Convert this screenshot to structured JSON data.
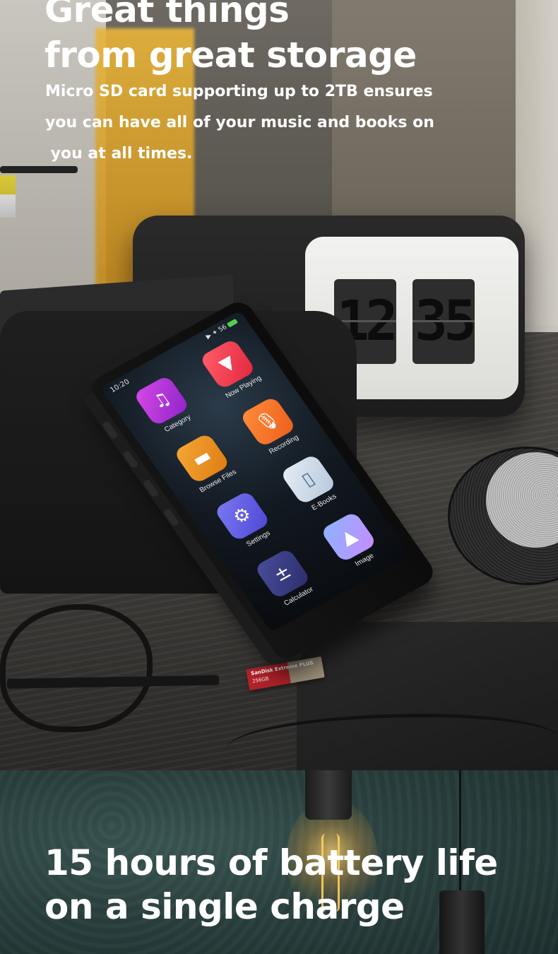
{
  "section_storage": {
    "headline_lines": [
      "Great things",
      "from great storage"
    ],
    "description_lines": [
      "Micro SD card supporting up to 2TB ensures",
      "you can have all of your music and books on",
      " you at all times."
    ],
    "clock": {
      "hour": "12",
      "minute": "35"
    },
    "sd_card": {
      "brand": "SanDisk Extreme PLUS",
      "capacity": "256GB"
    },
    "device": {
      "status_time": "10:20",
      "status_icons": "▶ ✦ 56",
      "apps": [
        {
          "label": "Category",
          "icon": "music-note-icon",
          "glyph": "♫"
        },
        {
          "label": "Now Playing",
          "icon": "play-icon",
          "glyph": "▼"
        },
        {
          "label": "Browse Files",
          "icon": "folder-icon",
          "glyph": "▬"
        },
        {
          "label": "Recording",
          "icon": "microphone-icon",
          "glyph": "🎙"
        },
        {
          "label": "Settings",
          "icon": "gear-icon",
          "glyph": "⚙"
        },
        {
          "label": "E-Books",
          "icon": "book-icon",
          "glyph": "▯"
        },
        {
          "label": "Calculator",
          "icon": "calculator-icon",
          "glyph": "±"
        },
        {
          "label": "Image",
          "icon": "image-icon",
          "glyph": "▲"
        }
      ]
    }
  },
  "section_battery": {
    "headline_lines": [
      "15 hours of battery life",
      "on a single charge"
    ]
  },
  "colors": {
    "text": "#ffffff",
    "battery_section_bg": "#2a413f",
    "bulb_glow": "#ffcf5a",
    "sd_card_red": "#b1222a"
  }
}
